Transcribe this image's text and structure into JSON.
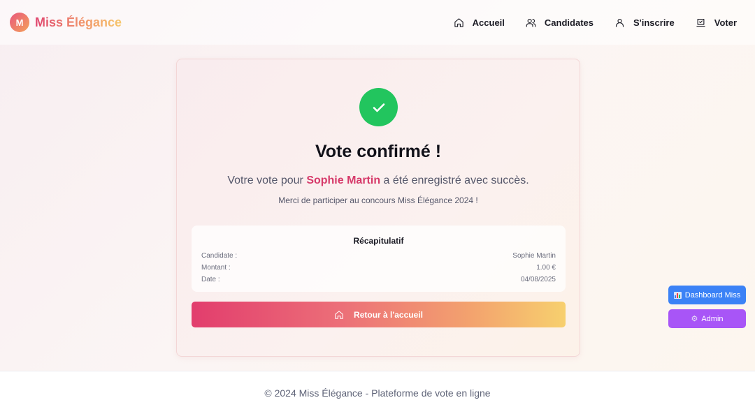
{
  "header": {
    "logo_letter": "M",
    "brand_name": "Miss Élégance",
    "nav": [
      {
        "label": "Accueil",
        "icon": "home-icon"
      },
      {
        "label": "Candidates",
        "icon": "users-icon"
      },
      {
        "label": "S'inscrire",
        "icon": "user-icon"
      },
      {
        "label": "Voter",
        "icon": "vote-icon"
      }
    ]
  },
  "confirmation": {
    "title": "Vote confirmé !",
    "message_prefix": "Votre vote pour ",
    "candidate_name": "Sophie Martin",
    "message_suffix": " a été enregistré avec succès.",
    "thanks": "Merci de participer au concours Miss Élégance 2024 !",
    "status_color": "#22c55e",
    "summary": {
      "title": "Récapitulatif",
      "rows": [
        {
          "label": "Candidate :",
          "value": "Sophie Martin"
        },
        {
          "label": "Montant :",
          "value": "1.00 €"
        },
        {
          "label": "Date :",
          "value": "04/08/2025"
        }
      ]
    },
    "home_button": "Retour à l'accueil"
  },
  "floating": {
    "dashboard_label": "Dashboard Miss",
    "admin_label": "Admin",
    "dashboard_color": "#3b82f6",
    "admin_color": "#a855f7"
  },
  "footer": {
    "text": "© 2024 Miss Élégance - Plateforme de vote en ligne"
  }
}
